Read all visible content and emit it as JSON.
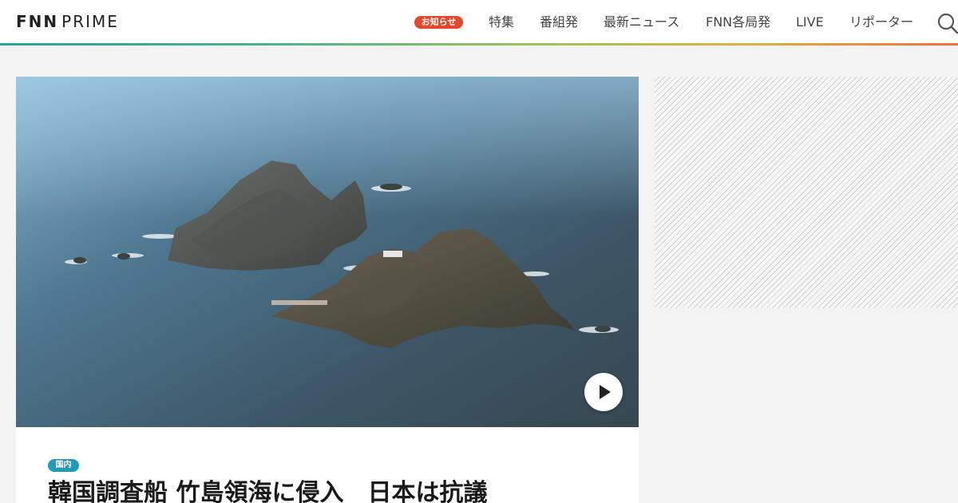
{
  "header": {
    "logo_main": "FNN",
    "logo_sub": "PRIME",
    "notice_badge": "お知らせ",
    "nav": [
      {
        "label": "特集"
      },
      {
        "label": "番組発"
      },
      {
        "label": "最新ニュース"
      },
      {
        "label": "FNN各局発"
      },
      {
        "label": "LIVE"
      },
      {
        "label": "リポーター"
      }
    ],
    "search_icon": "search-icon",
    "stripe_colors": [
      "#2e9ea3",
      "#4fb28c",
      "#9bc25a",
      "#e0b13f",
      "#ef6f43"
    ]
  },
  "article": {
    "category": "国内",
    "headline": "韓国調査船 竹島領海に侵入　日本は抗議",
    "play_icon": "play-icon",
    "category_color": "#1f9bb8"
  },
  "colors": {
    "notice": "#e6472b",
    "background": "#f3f3f3"
  }
}
